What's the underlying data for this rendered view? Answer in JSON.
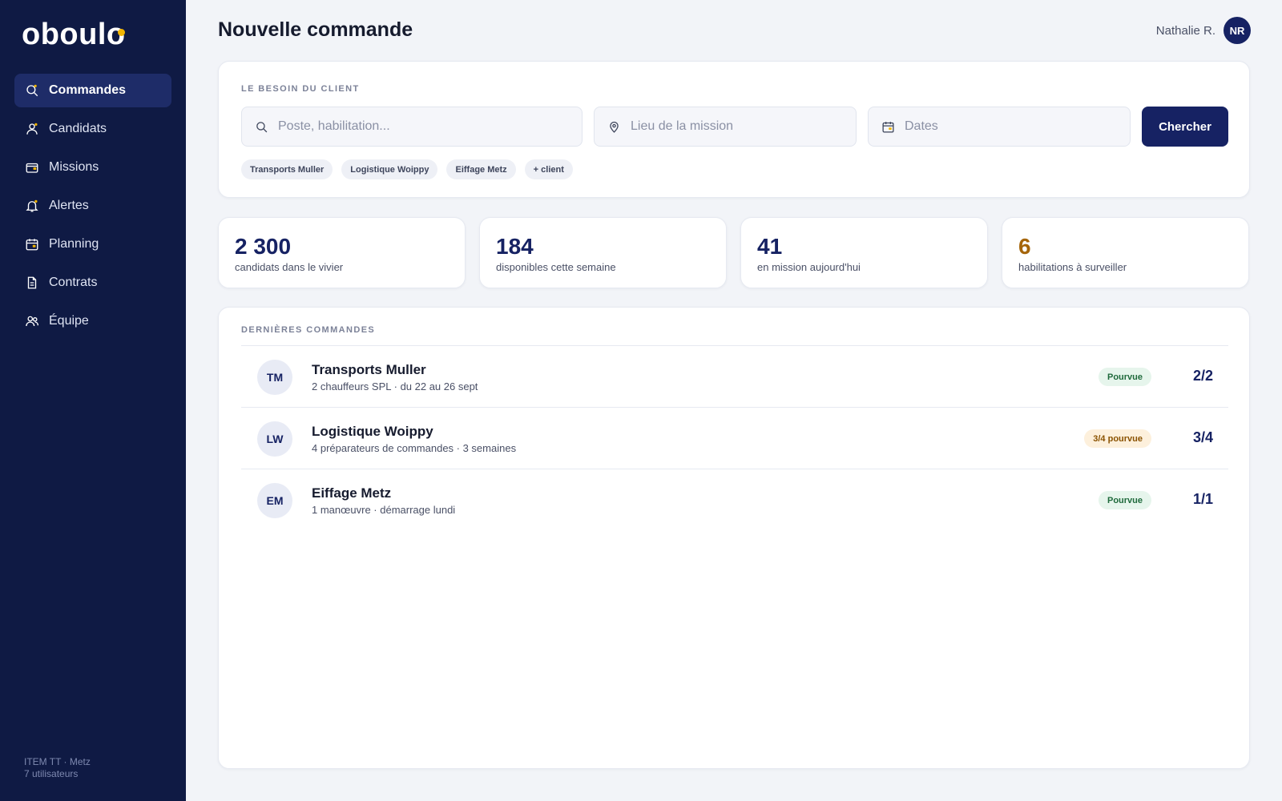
{
  "app": {
    "logo": "oboulo",
    "brand_accent": "#f0b400",
    "sidebar_bg": "#0f1a44"
  },
  "sidebar": {
    "items": [
      {
        "label": "Commandes",
        "icon": "search-icon",
        "active": true
      },
      {
        "label": "Candidats",
        "icon": "user-icon",
        "active": false
      },
      {
        "label": "Missions",
        "icon": "wallet-icon",
        "active": false
      },
      {
        "label": "Alertes",
        "icon": "bell-icon",
        "active": false
      },
      {
        "label": "Planning",
        "icon": "calendar-icon",
        "active": false
      },
      {
        "label": "Contrats",
        "icon": "document-icon",
        "active": false
      },
      {
        "label": "Équipe",
        "icon": "team-icon",
        "active": false
      }
    ],
    "footer_agency": "ITEM TT · Metz",
    "footer_users": "7 utilisateurs"
  },
  "header": {
    "title": "Nouvelle commande",
    "user_name": "Nathalie R.",
    "user_initials": "NR"
  },
  "search": {
    "section_label": "LE BESOIN DU CLIENT",
    "poste_placeholder": "Poste, habilitation...",
    "lieu_placeholder": "Lieu de la mission",
    "dates_placeholder": "Dates",
    "button_label": "Chercher",
    "chips": [
      "Transports Muller",
      "Logistique Woippy",
      "Eiffage Metz",
      "+ client"
    ]
  },
  "stats": [
    {
      "value": "2 300",
      "label": "candidats dans le vivier",
      "color": "#162263"
    },
    {
      "value": "184",
      "label": "disponibles cette semaine",
      "color": "#162263"
    },
    {
      "value": "41",
      "label": "en mission aujourd'hui",
      "color": "#162263"
    },
    {
      "value": "6",
      "label": "habilitations à surveiller",
      "color": "#a5650a"
    }
  ],
  "orders": {
    "section_label": "DERNIÈRES COMMANDES",
    "rows": [
      {
        "initials": "TM",
        "client": "Transports Muller",
        "details": "2 chauffeurs SPL · du 22 au 26 sept",
        "status": "Pourvue",
        "status_kind": "ok",
        "filled": "2/2"
      },
      {
        "initials": "LW",
        "client": "Logistique Woippy",
        "details": "4 préparateurs de commandes · 3 semaines",
        "status": "3/4 pourvue",
        "status_kind": "warn",
        "filled": "3/4"
      },
      {
        "initials": "EM",
        "client": "Eiffage Metz",
        "details": "1 manœuvre · démarrage lundi",
        "status": "Pourvue",
        "status_kind": "ok",
        "filled": "1/1"
      }
    ]
  }
}
